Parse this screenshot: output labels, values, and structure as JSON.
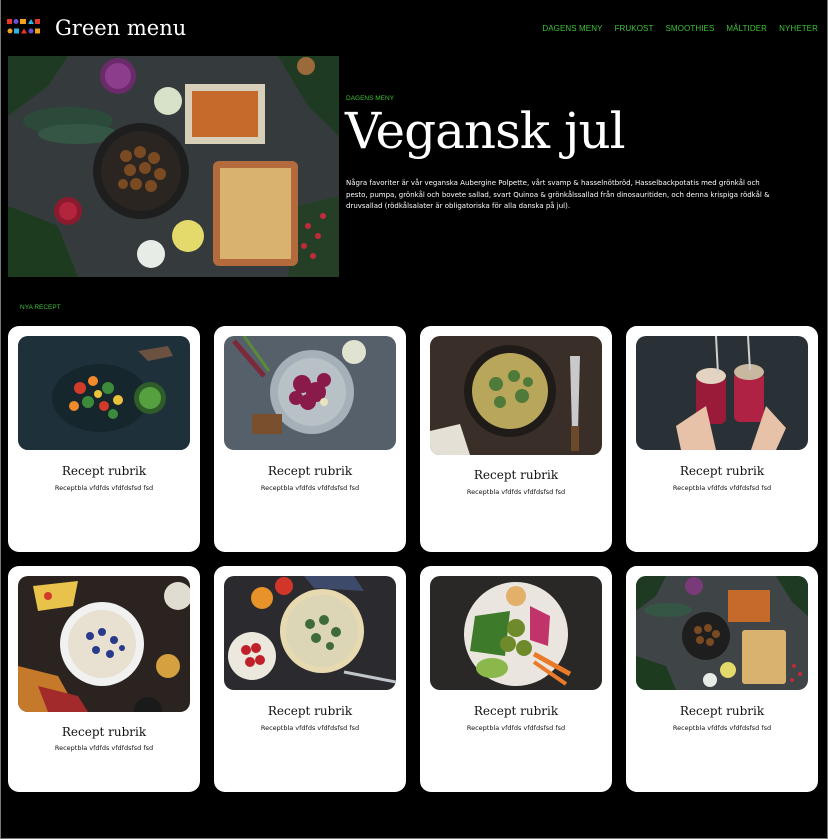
{
  "header": {
    "brand": "Green menu",
    "nav": [
      "DAGENS MENY",
      "FRUKOST",
      "SMOOTHIES",
      "MÅLTIDER",
      "NYHETER"
    ]
  },
  "hero": {
    "kicker": "DAGENS MENY",
    "title": "Vegansk jul",
    "text": "Några favoriter är vår veganska Aubergine Polpette, vårt svamp & hasselnötbröd, Hasselbackpotatis med grönkål och pesto, pumpa, grönkål och bovete sallad, svart Quinoa & grönkålssallad från dinosauritiden, och denna krispiga rödkål & druvsallad (rödkålsalater är obligatoriska för alla danska på jul)."
  },
  "section": {
    "kicker": "NYA RECEPT"
  },
  "cards": [
    {
      "title": "Recept rubrik",
      "desc": "Receptbla vfdfds vfdfdsfsd fsd"
    },
    {
      "title": "Recept rubrik",
      "desc": "Receptbla vfdfds vfdfdsfsd fsd"
    },
    {
      "title": "Recept rubrik",
      "desc": "Receptbla vfdfds vfdfdsfsd fsd"
    },
    {
      "title": "Recept rubrik",
      "desc": "Receptbla vfdfds vfdfdsfsd fsd"
    },
    {
      "title": "Recept rubrik",
      "desc": "Receptbla vfdfds vfdfdsfsd fsd"
    },
    {
      "title": "Recept rubrik",
      "desc": "Receptbla vfdfds vfdfdsfsd fsd"
    },
    {
      "title": "Recept rubrik",
      "desc": "Receptbla vfdfds vfdfdsfsd fsd"
    },
    {
      "title": "Recept rubrik",
      "desc": "Receptbla vfdfds vfdfdsfsd fsd"
    }
  ],
  "colors": {
    "accent": "#3fc23a",
    "background": "#000000",
    "card": "#ffffff"
  },
  "icons": {
    "logo": "colorful-logo-icon"
  }
}
